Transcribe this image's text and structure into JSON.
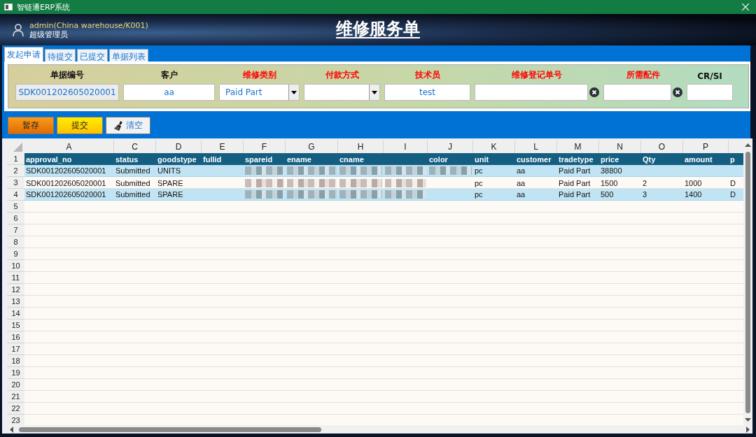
{
  "window": {
    "title": "智链通ERP系统"
  },
  "user": {
    "account": "admin(China warehouse/K001)",
    "role": "超级管理员"
  },
  "page_title": "维修服务单",
  "tabs": [
    {
      "label": "发起申请",
      "selected": true
    },
    {
      "label": "待提交",
      "selected": false
    },
    {
      "label": "已提交",
      "selected": false
    },
    {
      "label": "单据列表",
      "selected": false
    }
  ],
  "form": [
    {
      "label": "单据编号",
      "required": false,
      "kind": "readonly",
      "value": "SDK001202605020001"
    },
    {
      "label": "客户",
      "required": false,
      "kind": "text",
      "value": "aa"
    },
    {
      "label": "维修类别",
      "required": true,
      "kind": "dropdown",
      "value": "Paid Part"
    },
    {
      "label": "付款方式",
      "required": true,
      "kind": "dropdown"
    },
    {
      "label": "技术员",
      "required": true,
      "kind": "text",
      "value": "test"
    },
    {
      "label": "维修登记单号",
      "required": true,
      "kind": "clearable"
    },
    {
      "label": "所需配件",
      "required": true,
      "kind": "clearable"
    },
    {
      "label": "CR/SI",
      "required": false,
      "kind": "text"
    }
  ],
  "buttons": [
    {
      "label": "暂存",
      "kind": "orange"
    },
    {
      "label": "提交",
      "kind": "yellow"
    },
    {
      "label": "清空",
      "kind": "plain"
    }
  ],
  "sheet": {
    "columns": [
      "A",
      "C",
      "D",
      "E",
      "F",
      "G",
      "H",
      "I",
      "J",
      "K",
      "L",
      "M",
      "N",
      "O",
      "P"
    ],
    "rows": [
      {
        "number": "1",
        "kind": "header",
        "cells": {
          "A": "approval_no",
          "C": "status",
          "D": "goodstype",
          "E": "fullid",
          "F": "spareid",
          "G": "ename",
          "H": "cname",
          "J": "color",
          "K": "unit",
          "L": "customer",
          "M": "tradetype",
          "N": "price",
          "O": "Qty",
          "P": "amount",
          "Q": "p"
        }
      },
      {
        "number": "2",
        "kind": "data",
        "highlighted": true,
        "cells": {
          "A": "SDK001202605020001",
          "C": "Submitted",
          "D": "UNITS",
          "F": {
            "kind": "blurred"
          },
          "G": {
            "kind": "blurred"
          },
          "H": {
            "kind": "blurred"
          },
          "I": {
            "kind": "blurred"
          },
          "J": {
            "kind": "blurred"
          },
          "K": "pc",
          "L": "aa",
          "M": "Paid Part",
          "N": "38800"
        }
      },
      {
        "number": "3",
        "kind": "data",
        "highlighted": false,
        "cells": {
          "A": "SDK001202605020001",
          "C": "Submitted",
          "D": "SPARE",
          "F": {
            "kind": "blurred"
          },
          "G": {
            "kind": "blurred"
          },
          "H": {
            "kind": "blurred"
          },
          "I": {
            "kind": "blurred"
          },
          "K": "pc",
          "L": "aa",
          "M": "Paid Part",
          "N": "1500",
          "O": "2",
          "P": "1000",
          "Q": "D"
        }
      },
      {
        "number": "4",
        "kind": "data",
        "highlighted": true,
        "cells": {
          "A": "SDK001202605020001",
          "C": "Submitted",
          "D": "SPARE",
          "F": {
            "kind": "blurred"
          },
          "G": {
            "kind": "blurred"
          },
          "H": {
            "kind": "blurred"
          },
          "I": {
            "kind": "blurred"
          },
          "K": "pc",
          "L": "aa",
          "M": "Paid Part",
          "N": "500",
          "O": "3",
          "P": "1400",
          "Q": "D"
        }
      },
      {
        "number": "5"
      },
      {
        "number": "6"
      },
      {
        "number": "7"
      },
      {
        "number": "8"
      },
      {
        "number": "9"
      },
      {
        "number": "10"
      },
      {
        "number": "11"
      },
      {
        "number": "12"
      },
      {
        "number": "13"
      },
      {
        "number": "14"
      },
      {
        "number": "15"
      },
      {
        "number": "16"
      },
      {
        "number": "17"
      },
      {
        "number": "18"
      },
      {
        "number": "19"
      },
      {
        "number": "20"
      },
      {
        "number": "21"
      },
      {
        "number": "22"
      },
      {
        "number": "23"
      }
    ]
  }
}
